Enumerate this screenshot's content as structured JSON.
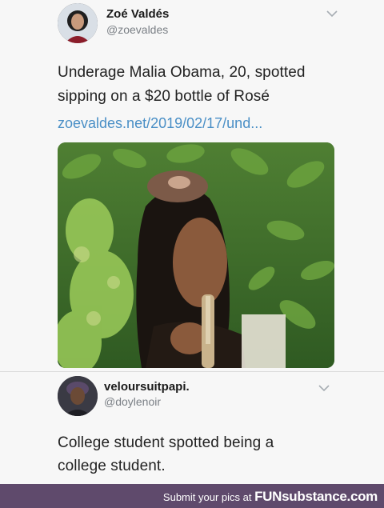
{
  "tweet1": {
    "name": "Zoé Valdés",
    "handle": "@zoevaldes",
    "text_line1": "Underage Malia Obama, 20, spotted",
    "text_line2": "sipping on a $20 bottle of Rosé",
    "link": "zoevaldes.net/2019/02/17/und...",
    "avatar_icon": "person-avatar-icon",
    "menu_icon": "chevron-down-icon"
  },
  "tweet2": {
    "name": "veloursuitpapi.",
    "handle": "@doylenoir",
    "text_line1": "College student spotted being a",
    "text_line2": "college student.",
    "avatar_icon": "person-avatar-icon",
    "menu_icon": "chevron-down-icon"
  },
  "footer": {
    "prefix": "Submit your pics at",
    "brand": "FUNsubstance.com",
    "bg_color": "#5f4a6c"
  },
  "colors": {
    "link": "#4a8fc6",
    "handle": "#7a7f85",
    "background": "#f7f7f7"
  }
}
